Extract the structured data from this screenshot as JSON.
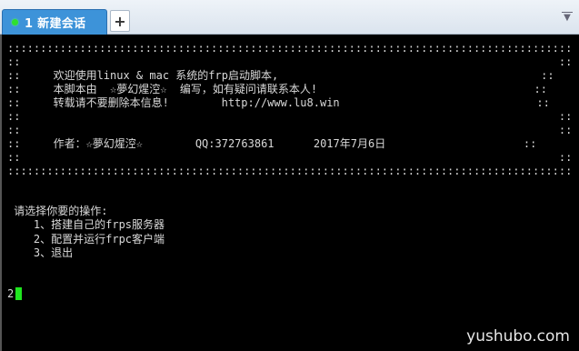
{
  "tab": {
    "label": "1 新建会话",
    "new_tab_symbol": "+"
  },
  "terminal": {
    "lines": [
      "::::::::::::::::::::::::::::::::::::::::::::::::::::::::::::::::::::::::::::::::::::::",
      "::                                                                                  ::",
      "::     欢迎使用linux & mac 系统的frp启动脚本,                                        ::",
      "::     本脚本由  ☆夢幻煋涳☆  编写，如有疑问请联系本人!                                 ::",
      "::     转载请不要删除本信息!        http://www.lu8.win                              ::",
      "::                                                                                  ::",
      "::                                                                                  ::",
      "::     作者：☆夢幻煋涳☆        QQ:372763861      2017年7月6日                     ::",
      "::                                                                                  ::",
      "::::::::::::::::::::::::::::::::::::::::::::::::::::::::::::::::::::::::::::::::::::::",
      "",
      "",
      " 请选择你要的操作:",
      "    1、搭建自己的frps服务器",
      "    2、配置并运行frpc客户端",
      "    3、退出",
      "",
      "",
      "2"
    ]
  },
  "watermark": "yushubo.com"
}
